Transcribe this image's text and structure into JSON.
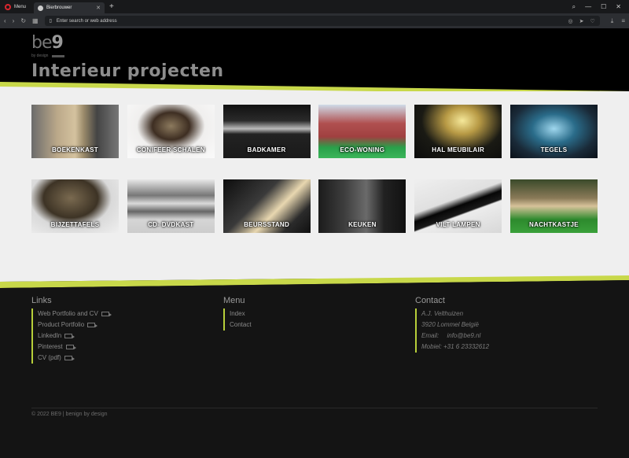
{
  "browser": {
    "menu_label": "Menu",
    "tab_title": "Bierbrouwer",
    "address_placeholder": "Enter search or web address"
  },
  "site": {
    "logo_text": "be",
    "logo_nine": "9",
    "logo_tagline": "by design",
    "page_title": "Interieur projecten",
    "accent": "#c8d84a"
  },
  "projects": [
    {
      "label": "BOEKENKAST"
    },
    {
      "label": "CONIFEER SCHALEN"
    },
    {
      "label": "BADKAMER"
    },
    {
      "label": "ECO-WONING"
    },
    {
      "label": "HAL MEUBILAIR"
    },
    {
      "label": "TEGELS"
    },
    {
      "label": "BIJZETTAFELS"
    },
    {
      "label": "CD- DVDKAST"
    },
    {
      "label": "BEURSSTAND"
    },
    {
      "label": "KEUKEN"
    },
    {
      "label": "VILT LAMPEN"
    },
    {
      "label": "NACHTKASTJE"
    }
  ],
  "footer": {
    "links_title": "Links",
    "links": [
      "Web Portfolio and CV",
      "Product Portfolio",
      "LinkedIn",
      "Pinterest",
      "CV (pdf)"
    ],
    "menu_title": "Menu",
    "menu": [
      "Index",
      "Contact"
    ],
    "contact_title": "Contact",
    "contact": {
      "name": "A.J. Velthuizen",
      "address": "3920 Lommel België",
      "email_label": "Email:",
      "email": "info@be9.nl",
      "mobile": "Mobiel: +31 6 23332612"
    },
    "copyright": "© 2022 BE9 | benign by design"
  }
}
